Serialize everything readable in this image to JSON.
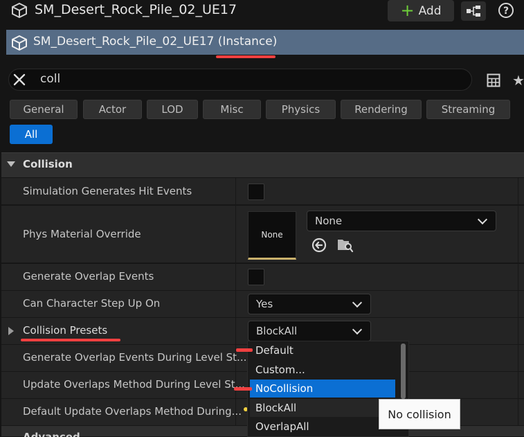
{
  "header": {
    "title": "SM_Desert_Rock_Pile_02_UE17",
    "add_label": "Add"
  },
  "instance": {
    "name": "SM_Desert_Rock_Pile_02_UE17",
    "suffix": "(Instance)"
  },
  "search": {
    "value": "coll"
  },
  "filter_tabs": [
    "General",
    "Actor",
    "LOD",
    "Misc",
    "Physics",
    "Rendering",
    "Streaming"
  ],
  "filter_all": "All",
  "section": {
    "title": "Collision"
  },
  "properties": {
    "sim_hit_events": "Simulation Generates Hit Events",
    "phys_material": "Phys Material Override",
    "phys_material_thumb": "None",
    "phys_material_value": "None",
    "gen_overlap": "Generate Overlap Events",
    "char_step": "Can Character Step Up On",
    "char_step_value": "Yes",
    "presets": "Collision Presets",
    "presets_value": "BlockAll",
    "gen_overlap_level": "Generate Overlap Events During Level St...",
    "update_overlaps": "Update Overlaps Method During Level St...",
    "default_update": "Default Update Overlaps Method During...",
    "advanced": "Advanced"
  },
  "dropdown": {
    "options": [
      "Default",
      "Custom...",
      "NoCollision",
      "BlockAll",
      "OverlapAll"
    ],
    "selected": "NoCollision"
  },
  "tooltip": "No collision",
  "colors": {
    "accent": "#0b6fd3",
    "instance_bar": "#566c86",
    "annotation": "#f04040"
  }
}
